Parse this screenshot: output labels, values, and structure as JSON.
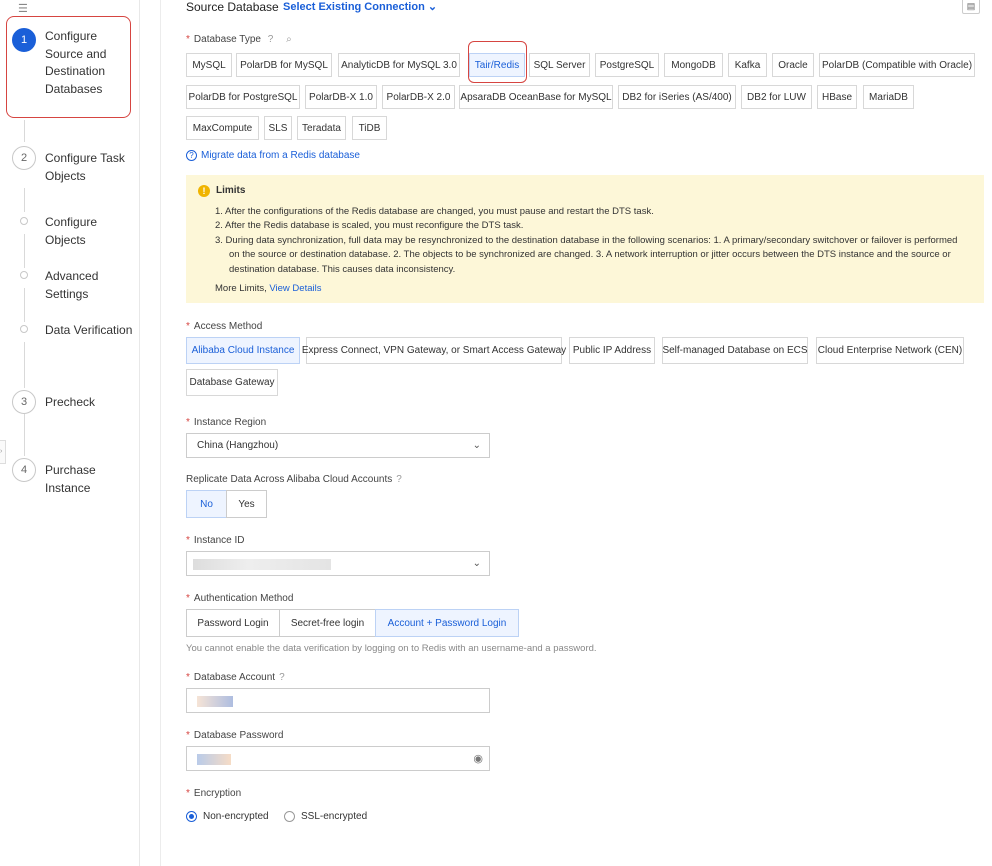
{
  "sidebar": {
    "collapse_icon": "menu-collapse-icon",
    "steps": [
      {
        "number": "1",
        "label": "Configure Source and Destination Databases",
        "active": true
      },
      {
        "number": "2",
        "label": "Configure Task Objects"
      },
      {
        "number": "",
        "label": "Configure Objects"
      },
      {
        "number": "",
        "label": "Advanced Settings"
      },
      {
        "number": "",
        "label": "Data Verification"
      },
      {
        "number": "3",
        "label": "Precheck"
      },
      {
        "number": "4",
        "label": "Purchase Instance"
      }
    ]
  },
  "header": {
    "title": "Source Database",
    "select_connection": "Select Existing Connection",
    "chevron": "⌄",
    "save_icon": "save-icon"
  },
  "database_type": {
    "label": "Database Type",
    "help": "?",
    "search": "⌕",
    "options": [
      "MySQL",
      "PolarDB for MySQL",
      "AnalyticDB for MySQL 3.0",
      "Tair/Redis",
      "SQL Server",
      "PostgreSQL",
      "MongoDB",
      "Kafka",
      "Oracle",
      "PolarDB (Compatible with Oracle)",
      "PolarDB for PostgreSQL",
      "PolarDB-X 1.0",
      "PolarDB-X 2.0",
      "ApsaraDB OceanBase for MySQL",
      "DB2 for iSeries (AS/400)",
      "DB2 for LUW",
      "HBase",
      "MariaDB",
      "MaxCompute",
      "SLS",
      "Teradata",
      "TiDB"
    ],
    "selected": "Tair/Redis"
  },
  "migrate_link": "Migrate data from a Redis database",
  "limits": {
    "title": "Limits",
    "items": [
      "1. After the configurations of the Redis database are changed, you must pause and restart the DTS task.",
      "2. After the Redis database is scaled, you must reconfigure the DTS task.",
      "3. During data synchronization, full data may be resynchronized to the destination database in the following scenarios: 1. A primary/secondary switchover or failover is performed",
      "on the source or destination database. 2. The objects to be synchronized are changed. 3. A network interruption or jitter occurs between the DTS instance and the source or",
      "destination database. This causes data inconsistency."
    ],
    "more_text": "More Limits,",
    "more_link": "View Details"
  },
  "access_method": {
    "label": "Access Method",
    "options": [
      "Alibaba Cloud Instance",
      "Express Connect, VPN Gateway, or Smart Access Gateway",
      "Public IP Address",
      "Self-managed Database on ECS",
      "Cloud Enterprise Network (CEN)",
      "Database Gateway"
    ],
    "selected": "Alibaba Cloud Instance"
  },
  "instance_region": {
    "label": "Instance Region",
    "value": "China (Hangzhou)",
    "chevron": "⌄"
  },
  "replicate": {
    "label": "Replicate Data Across Alibaba Cloud Accounts",
    "help": "?",
    "options": [
      "No",
      "Yes"
    ],
    "selected": "No"
  },
  "instance_id": {
    "label": "Instance ID",
    "chevron": "⌄"
  },
  "auth": {
    "label": "Authentication Method",
    "options": [
      "Password Login",
      "Secret-free login",
      "Account + Password Login"
    ],
    "selected": "Account + Password Login"
  },
  "auth_note": "You cannot enable the data verification by logging on to Redis with an username-and a password.",
  "account": {
    "label": "Database Account",
    "help": "?"
  },
  "password": {
    "label": "Database Password",
    "eye": "◉"
  },
  "encryption": {
    "label": "Encryption",
    "options": [
      "Non-encrypted",
      "SSL-encrypted"
    ],
    "selected": "Non-encrypted"
  },
  "colors": {
    "accent": "#1a5fd8",
    "highlight": "#d64541",
    "warning_bg": "#fdf7d8"
  }
}
